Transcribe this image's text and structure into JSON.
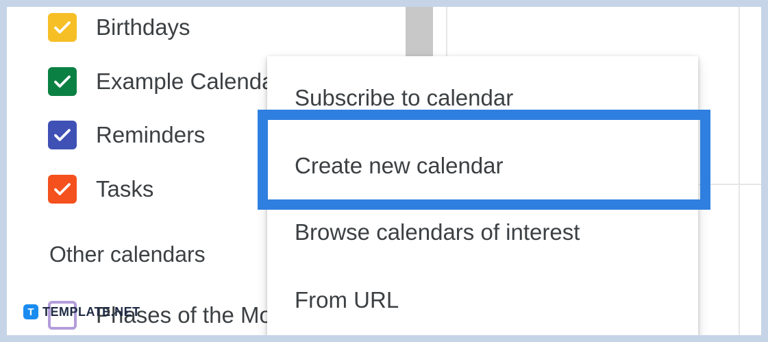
{
  "my_calendars": [
    {
      "label": "Birthdays",
      "color": "#f6bf26"
    },
    {
      "label": "Example Calendar",
      "color": "#0b8043"
    },
    {
      "label": "Reminders",
      "color": "#3f51b5"
    },
    {
      "label": "Tasks",
      "color": "#f4511e"
    }
  ],
  "other_calendars": {
    "title": "Other calendars",
    "items": [
      {
        "label": "Phases of the Moon",
        "color": "#b39ddb"
      }
    ]
  },
  "menu": {
    "items": [
      {
        "label": "Subscribe to calendar"
      },
      {
        "label": "Create new calendar",
        "highlighted": true
      },
      {
        "label": "Browse calendars of interest"
      },
      {
        "label": "From URL"
      }
    ],
    "highlight_color": "#2f7fe0"
  },
  "watermark": {
    "logo": "T",
    "text": "TEMPLATE.NET"
  }
}
